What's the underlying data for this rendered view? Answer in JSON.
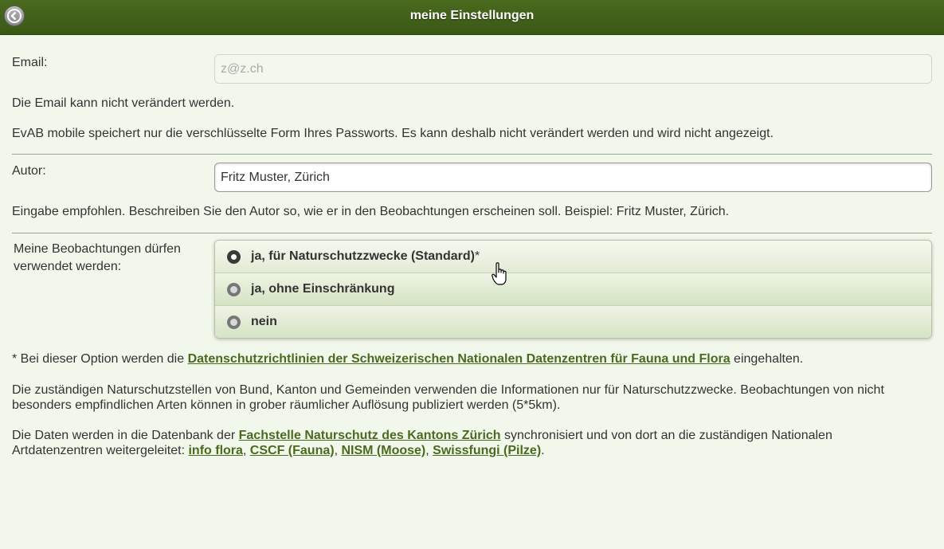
{
  "header": {
    "title": "meine Einstellungen",
    "back_icon": "back-arrow-icon"
  },
  "email": {
    "label": "Email:",
    "value": "z@z.ch",
    "note": "Die Email kann nicht verändert werden."
  },
  "password_note": "EvAB mobile speichert nur die verschlüsselte Form Ihres Passworts. Es kann deshalb nicht verändert werden und wird nicht angezeigt.",
  "autor": {
    "label": "Autor:",
    "value": "Fritz Muster, Zürich",
    "note": "Eingabe empfohlen. Beschreiben Sie den Autor so, wie er in den Beobachtungen erscheinen soll. Beispiel: Fritz Muster, Zürich."
  },
  "usage": {
    "label_line1": "Meine Beobachtungen dürfen",
    "label_line2": "verwendet werden:",
    "options": [
      {
        "label": "ja, für Naturschutzzwecke (Standard)",
        "suffix": "*",
        "selected": true
      },
      {
        "label": "ja, ohne Einschränkung",
        "selected": false
      },
      {
        "label": "nein",
        "selected": false
      }
    ]
  },
  "footnote": {
    "prefix": "* Bei dieser Option werden die ",
    "link": "Datenschutzrichtlinien der Schweizerischen Nationalen Datenzentren für Fauna und Flora",
    "suffix": " eingehalten."
  },
  "info1": "Die zuständigen Naturschutzstellen von Bund, Kanton und Gemeinden verwenden die Informationen nur für Naturschutzzwecke. Beobachtungen von nicht besonders empfindlichen Arten können in grober räumlicher Auflösung publiziert werden (5*5km).",
  "info2": {
    "prefix": "Die Daten werden in die Datenbank der ",
    "link_fachstelle": "Fachstelle Naturschutz des Kantons Zürich",
    "middle": " synchronisiert und von dort an die zuständigen Nationalen Artdatenzentren weitergeleitet: ",
    "link_infoflora": "info flora",
    "sep1": ", ",
    "link_cscf": "CSCF (Fauna)",
    "sep2": ", ",
    "link_nism": "NISM (Moose)",
    "sep3": ", ",
    "link_swissfungi": "Swissfungi (Pilze)",
    "end": "."
  },
  "colors": {
    "header": "#3f5e18",
    "link": "#4a6a1e",
    "background": "#f2f7ec"
  }
}
